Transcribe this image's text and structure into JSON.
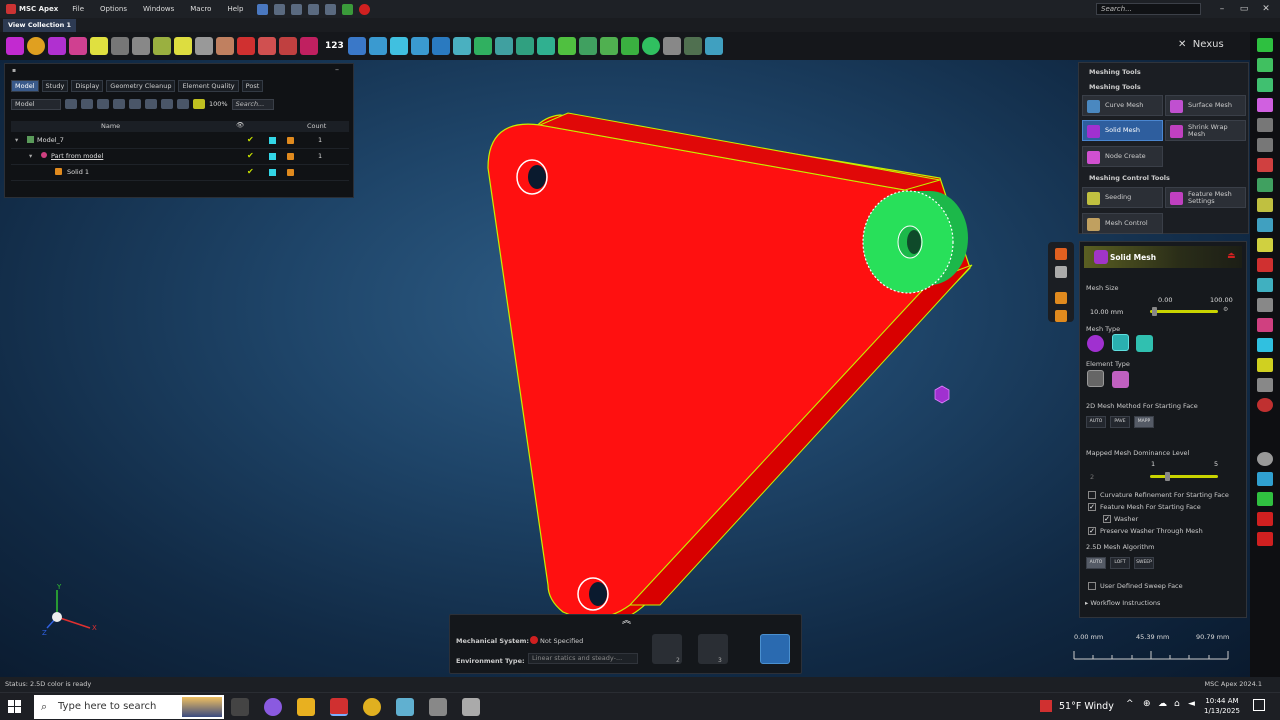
{
  "app": {
    "title": "MSC Apex",
    "version": "MSC Apex 2024.1"
  },
  "menus": [
    "File",
    "Options",
    "Windows",
    "Macro",
    "Help"
  ],
  "search": {
    "placeholder": "Search..."
  },
  "tabs": {
    "view_collection": "View Collection 1"
  },
  "toolbar": {
    "number_label": "123",
    "nexus_label": "Nexus"
  },
  "model_tree": {
    "tabs": [
      "Model",
      "Study",
      "Display",
      "Geometry Cleanup",
      "Element Quality",
      "Post"
    ],
    "dropdown": "Model",
    "zoom": "100%",
    "search": "Search...",
    "columns": {
      "name": "Name",
      "count": "Count"
    },
    "rows": [
      {
        "name": "Model_7",
        "count": "1"
      },
      {
        "name": "Part from model",
        "count": "1"
      },
      {
        "name": "Solid 1",
        "count": ""
      }
    ]
  },
  "meshing_tools": {
    "header": "Meshing Tools",
    "section1": "Meshing Tools",
    "buttons": [
      "Curve Mesh",
      "Surface Mesh",
      "Solid Mesh",
      "Shrink Wrap Mesh",
      "Node Create"
    ],
    "section2": "Meshing Control Tools",
    "control_buttons": [
      "Seeding",
      "Feature Mesh Settings",
      "Mesh Control"
    ]
  },
  "solid_mesh": {
    "title": "Solid Mesh",
    "mesh_size_label": "Mesh Size",
    "mesh_size_value": "10.00 mm",
    "slider_min": "0.00",
    "slider_max": "100.00",
    "slider_level": 0.06,
    "mesh_type_label": "Mesh Type",
    "element_type_label": "Element Type",
    "method_label": "2D Mesh Method For Starting Face",
    "method_options": [
      "AUTO",
      "PAVE",
      "MAPP"
    ],
    "dominance_label": "Mapped Mesh Dominance Level",
    "dominance_value": "2",
    "dominance_min": "1",
    "dominance_max": "5",
    "dominance_level": 0.25,
    "checks": [
      {
        "label": "Curvature Refinement For Starting Face",
        "checked": false
      },
      {
        "label": "Feature Mesh For Starting Face",
        "checked": true
      },
      {
        "label": "Washer",
        "checked": true
      },
      {
        "label": "Preserve Washer Through Mesh",
        "checked": true
      }
    ],
    "algo_label": "2.5D Mesh Algorithm",
    "algo_options": [
      "AUTO",
      "LOFT",
      "SWEEP"
    ],
    "sweep_label": "User Defined Sweep Face",
    "sweep_checked": false,
    "workflow": "Workflow Instructions"
  },
  "bottom_dialog": {
    "mech_label": "Mechanical System:",
    "mech_value": "Not Specified",
    "env_label": "Environment Type:",
    "env_value": "Linear statics and steady-...",
    "badge1": "2",
    "badge2": "3"
  },
  "scale": {
    "v0": "0.00 mm",
    "v1": "45.39 mm",
    "v2": "90.79 mm"
  },
  "axes": {
    "x": "X",
    "y": "Y",
    "z": "Z"
  },
  "status": {
    "text": "Status:  2.5D color is ready"
  },
  "taskbar": {
    "search": "Type here to search",
    "weather": "51°F  Windy",
    "time": "10:44 AM",
    "date": "1/13/2025"
  },
  "colors": {
    "part": "#ff0000",
    "edge": "#c6f000",
    "pin": "#22dd55",
    "accent": "#3a5a8a"
  }
}
